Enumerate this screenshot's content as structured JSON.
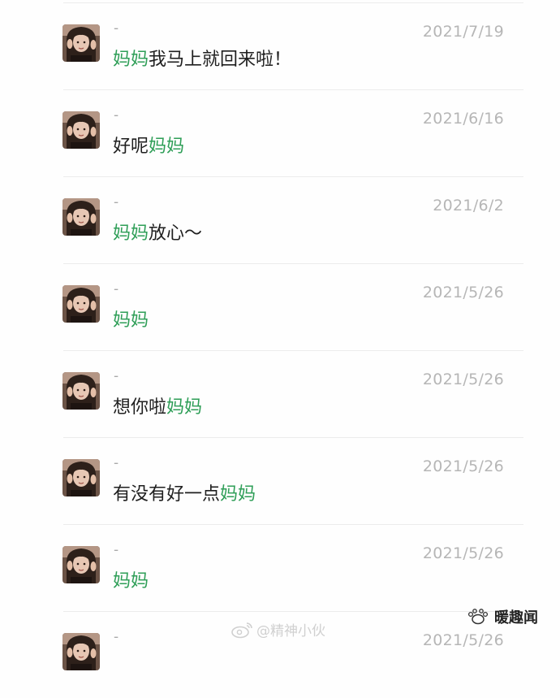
{
  "conversation": {
    "items": [
      {
        "name": "-",
        "date": "2021/7/19",
        "message": [
          {
            "text": "妈妈",
            "hl": true
          },
          {
            "text": "我马上就回来啦！",
            "hl": false
          }
        ]
      },
      {
        "name": "-",
        "date": "2021/6/16",
        "message": [
          {
            "text": "好呢",
            "hl": false
          },
          {
            "text": "妈妈",
            "hl": true
          }
        ]
      },
      {
        "name": "-",
        "date": "2021/6/2",
        "message": [
          {
            "text": "妈妈",
            "hl": true
          },
          {
            "text": "放心～",
            "hl": false
          }
        ]
      },
      {
        "name": "-",
        "date": "2021/5/26",
        "message": [
          {
            "text": "妈妈",
            "hl": true
          }
        ]
      },
      {
        "name": "-",
        "date": "2021/5/26",
        "message": [
          {
            "text": "想你啦",
            "hl": false
          },
          {
            "text": "妈妈",
            "hl": true
          }
        ]
      },
      {
        "name": "-",
        "date": "2021/5/26",
        "message": [
          {
            "text": "有没有好一点",
            "hl": false
          },
          {
            "text": "妈妈",
            "hl": true
          }
        ]
      },
      {
        "name": "-",
        "date": "2021/5/26",
        "message": [
          {
            "text": "妈妈",
            "hl": true
          }
        ]
      },
      {
        "name": "-",
        "date": "2021/5/26",
        "message": []
      }
    ]
  },
  "watermark": {
    "text": "@精神小伙",
    "icon": "weibo-icon"
  },
  "logo": {
    "text": "暖趣闻",
    "icon": "paw-icon"
  },
  "colors": {
    "highlight": "#2e9e57",
    "date": "#b6b6b6",
    "divider": "#ececec"
  }
}
